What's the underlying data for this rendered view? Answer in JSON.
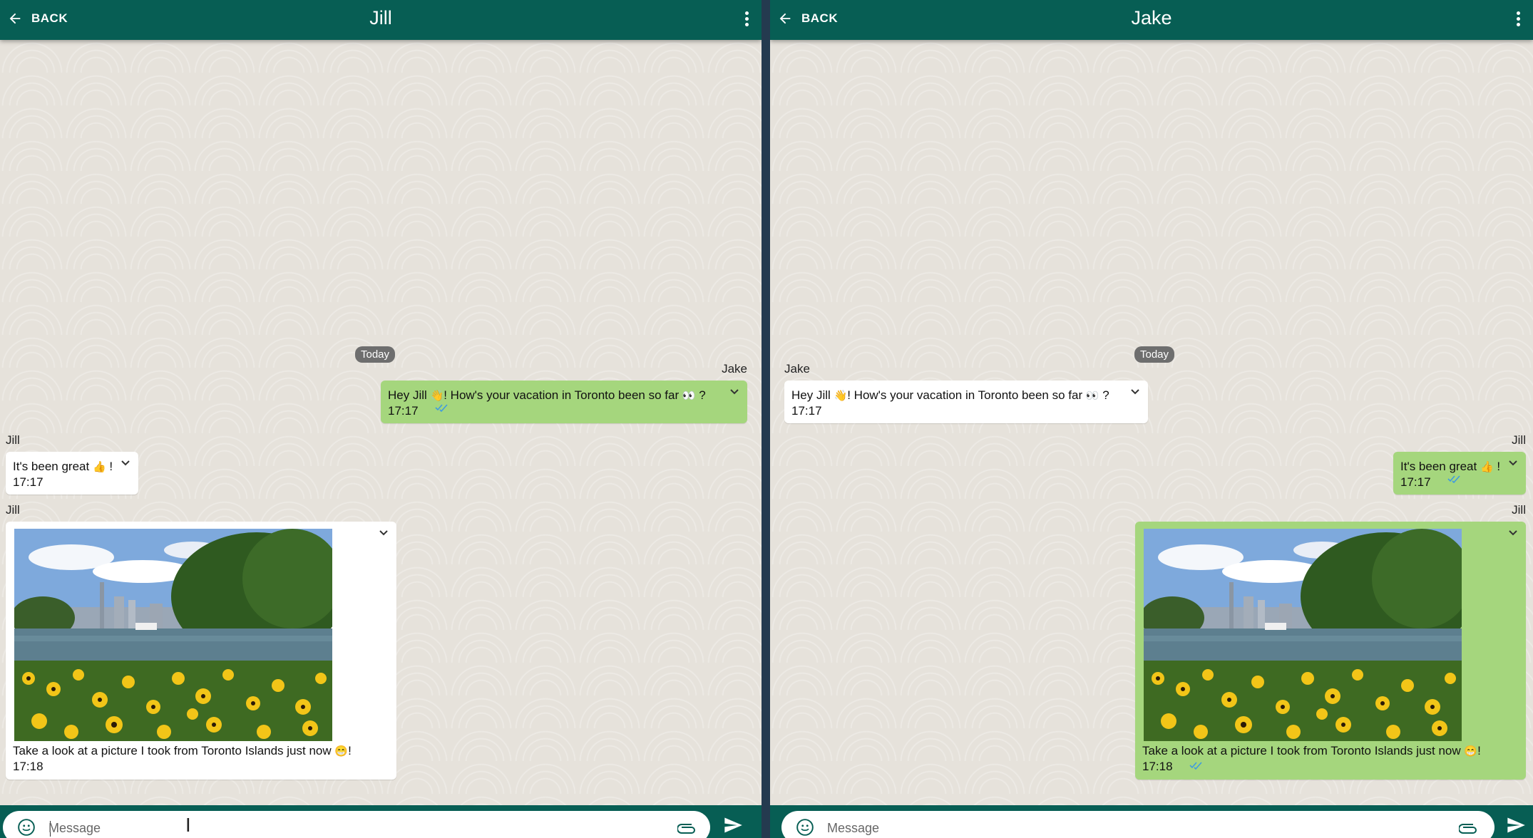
{
  "colors": {
    "header": "#075e54",
    "outgoing": "#a5d67d",
    "incoming": "#ffffff",
    "chat_bg": "#e6e2db",
    "ticks": "#3f9be0"
  },
  "left": {
    "back_label": "BACK",
    "title": "Jill",
    "today": "Today",
    "msg1": {
      "sender": "Jake",
      "text_before": "Hey Jill",
      "emoji1": "👋",
      "text_mid": "! How's your vacation in Toronto been so far",
      "emoji2": "👀",
      "text_after": "?",
      "time": "17:17"
    },
    "msg2": {
      "sender": "Jill",
      "text_before": "It's been great",
      "emoji": "👍",
      "text_after": "!",
      "time": "17:17"
    },
    "msg3": {
      "sender": "Jill",
      "caption": "Take a look at a picture I took from Toronto Islands just now",
      "emoji": "😁",
      "caption_after": "!",
      "time": "17:18",
      "image": "toronto-islands-photo"
    },
    "input": {
      "placeholder": "Message"
    }
  },
  "right": {
    "back_label": "BACK",
    "title": "Jake",
    "today": "Today",
    "msg1": {
      "sender": "Jake",
      "text_before": "Hey Jill",
      "emoji1": "👋",
      "text_mid": "! How's your vacation in Toronto been so far",
      "emoji2": "👀",
      "text_after": "?",
      "time": "17:17"
    },
    "msg2": {
      "sender": "Jill",
      "text_before": "It's been great",
      "emoji": "👍",
      "text_after": "!",
      "time": "17:17"
    },
    "msg3": {
      "sender": "Jill",
      "caption": "Take a look at a picture I took from Toronto Islands just now",
      "emoji": "😁",
      "caption_after": "!",
      "time": "17:18",
      "image": "toronto-islands-photo"
    },
    "input": {
      "placeholder": "Message"
    }
  },
  "icons": [
    "back-arrow-icon",
    "more-vert-icon",
    "emoji-icon",
    "paperclip-icon",
    "send-icon",
    "chevron-down-icon",
    "double-check-icon"
  ]
}
